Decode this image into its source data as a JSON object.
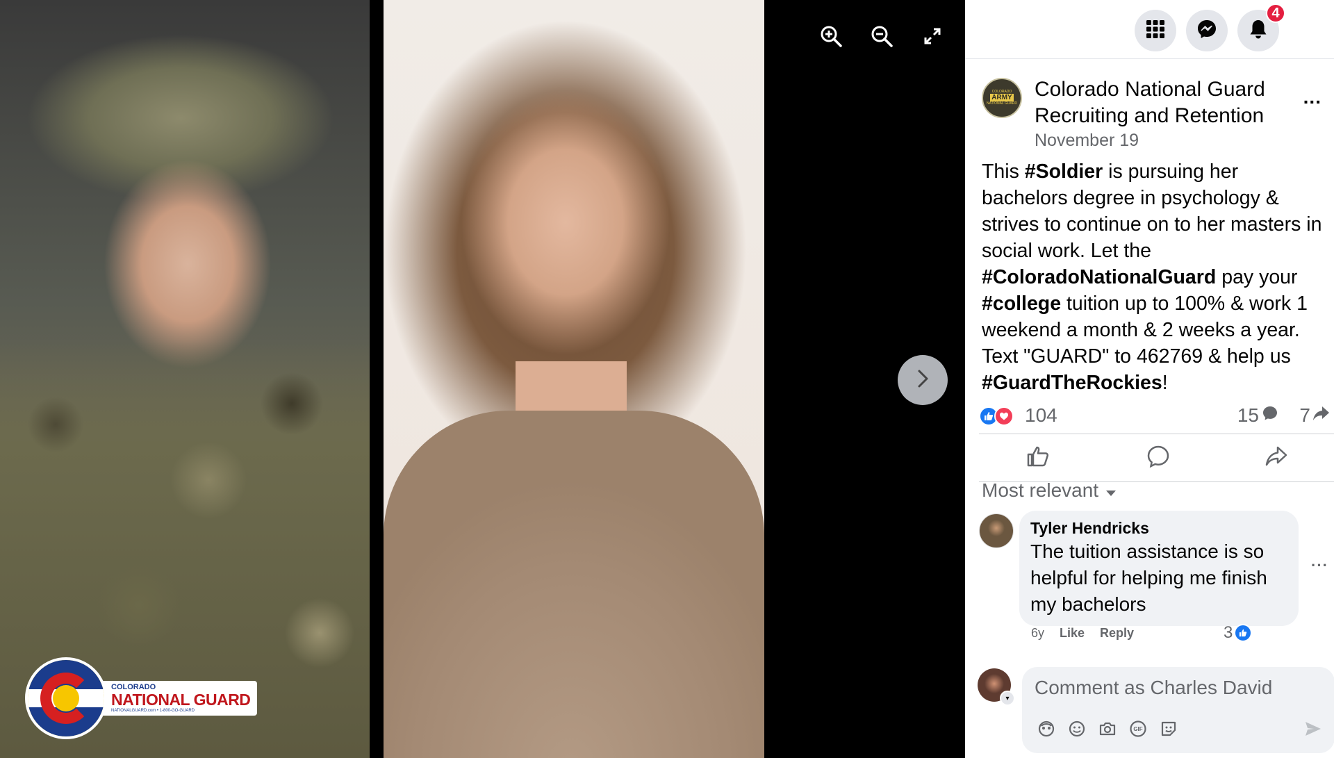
{
  "viewer": {
    "logo_line1": "COLORADO",
    "logo_line2": "NATIONAL GUARD",
    "logo_line3": "NATIONALGUARD.com • 1-800-GO-GUARD",
    "tools": [
      "zoom-in-icon",
      "zoom-out-icon",
      "fullscreen-icon"
    ],
    "next_icon": "chevron-right-icon"
  },
  "topbar": {
    "notifications_count": "4"
  },
  "post": {
    "page_avatar": {
      "line1": "COLORADO",
      "line2": "ARMY",
      "line3": "NATIONAL GUARD"
    },
    "page_name": "Colorado National Guard Recruiting and Retention",
    "date": "November 19",
    "more_label": "...",
    "text": {
      "s1": "This ",
      "t1": "#Soldier",
      "s2": " is pursuing her bachelors degree in psychology & strives to continue on to her masters in social work. Let the ",
      "t2": "#ColoradoNationalGuard",
      "s3": " pay your ",
      "t3": "#college",
      "s4": " tuition up to 100% & work 1 weekend a month & 2 weeks a year. Text \"GUARD\" to 462769 & help us ",
      "t4": "#GuardTheRockies",
      "s5": "!"
    },
    "reaction_count": "104",
    "comment_count": "15",
    "share_count": "7"
  },
  "comments": {
    "sort_label": "Most relevant",
    "items": [
      {
        "author": "Tyler Hendricks",
        "text": "The tuition assistance is so helpful for helping me finish my bachelors",
        "age": "6y",
        "like_label": "Like",
        "reply_label": "Reply",
        "likes": "3"
      }
    ],
    "composer_placeholder": "Comment as Charles David"
  },
  "colors": {
    "facebook_blue": "#1877f2",
    "love_red": "#f33e58",
    "badge_red": "#e41e3f",
    "secondary_text": "#65676b",
    "bubble_bg": "#f0f2f5"
  }
}
